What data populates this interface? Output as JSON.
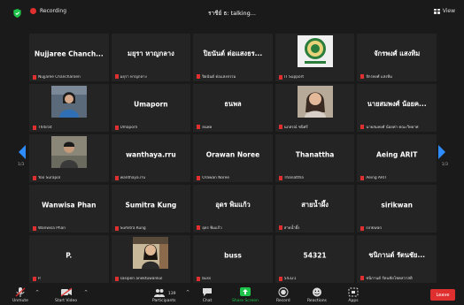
{
  "topbar": {
    "recording_label": "Recording",
    "speaking_label": "ราชีย์ ธ: talking...",
    "view_label": "View"
  },
  "pagination": {
    "left": "1/3",
    "right": "1/3"
  },
  "tiles": [
    {
      "big": "Nujjaree Chanch...",
      "foot": "Nujjaree Chancharoen"
    },
    {
      "big": "มยุรา หาญกลาง",
      "foot": "มยุรา หาญกลาง"
    },
    {
      "big": "ปิยนันต์ ต่อแสงธร...",
      "foot": "ปิยนันต์ ต่อแสงธรรม"
    },
    {
      "big": "",
      "foot": "IT Support"
    },
    {
      "big": "จักรพงศ์ แสงทิม",
      "foot": "จักรพงศ์ แสงทิม"
    },
    {
      "big": "",
      "foot": "Thitirat"
    },
    {
      "big": "Umaporn",
      "foot": "Umaporn"
    },
    {
      "big": "ธนพล",
      "foot": "ธนพล"
    },
    {
      "big": "",
      "foot": "นภสรณ์ ชนิศรี"
    },
    {
      "big": "นายสมพงศ์ น้อยค...",
      "foot": "นายสมพงศ์ น้อยค่า คณะวิทยาศ"
    },
    {
      "big": "",
      "foot": "Yoo Surapol"
    },
    {
      "big": "wanthaya.rru",
      "foot": "wanthaya.rru"
    },
    {
      "big": "Orawan Noree",
      "foot": "Orawan Noree"
    },
    {
      "big": "Thanattha",
      "foot": "Thanattha"
    },
    {
      "big": "Aeing ARIT",
      "foot": "Aeing ARIT"
    },
    {
      "big": "Wanwisa Phan",
      "foot": "Wanwisa Phan"
    },
    {
      "big": "Sumitra Kung",
      "foot": "Sumitra Kung"
    },
    {
      "big": "อุดร พิมแก้ว",
      "foot": "อุดร พิมแก้ว"
    },
    {
      "big": "สายน้ำผึ้ง",
      "foot": "สายน้ำผึ้ง"
    },
    {
      "big": "sirikwan",
      "foot": "sirikwan"
    },
    {
      "big": "P.",
      "foot": "P."
    },
    {
      "big": "",
      "foot": "sasipen anektuwankul"
    },
    {
      "big": "buss",
      "foot": "buss"
    },
    {
      "big": "54321",
      "foot": "54321"
    },
    {
      "big": "ชนิกานต์ รัตนชัย...",
      "foot": "ชนิกานต์ รัตนชัยโชคสวาสดิ"
    }
  ],
  "toolbar": {
    "unmute": "Unmute",
    "start_video": "Start Video",
    "participants": "Participants",
    "participants_count": "139",
    "chat": "Chat",
    "share_screen": "Share Screen",
    "record": "Record",
    "reactions": "Reactions",
    "apps": "Apps",
    "leave": "Leave"
  },
  "colors": {
    "accent": "#2d8cff",
    "danger": "#e02f2f",
    "share": "#1ec44a",
    "tile": "#242424"
  }
}
